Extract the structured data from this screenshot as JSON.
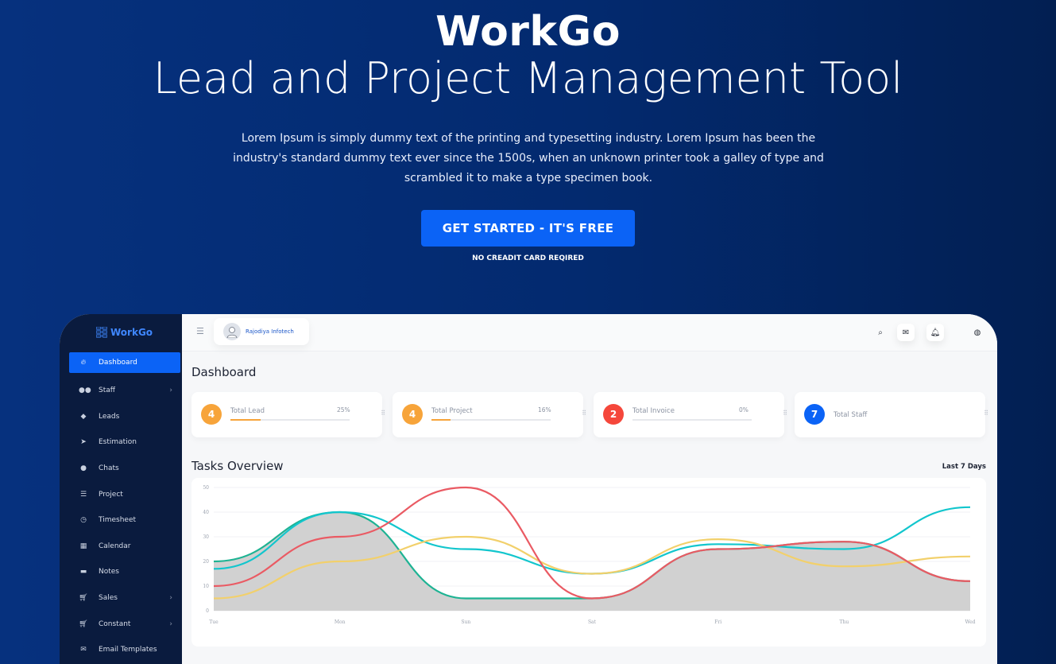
{
  "hero": {
    "brand": "WorkGo",
    "headline": "Lead and Project Management Tool",
    "description": "Lorem Ipsum is simply dummy text of the printing and typesetting industry. Lorem Ipsum has been the industry's standard dummy text ever since the 1500s, when an unknown printer took a galley of type and scrambled it to make a type specimen book.",
    "cta_label": "GET STARTED - IT'S FREE",
    "cta_note": "NO CREADIT CARD REQIRED"
  },
  "app": {
    "logo": "WorkGo",
    "sidebar": {
      "items": [
        {
          "label": "Dashboard",
          "icon": "fire-icon",
          "active": true
        },
        {
          "label": "Staff",
          "icon": "users-icon",
          "chevron": true
        },
        {
          "label": "Leads",
          "icon": "cube-icon"
        },
        {
          "label": "Estimation",
          "icon": "paper-plane-icon"
        },
        {
          "label": "Chats",
          "icon": "chat-icon"
        },
        {
          "label": "Project",
          "icon": "list-icon"
        },
        {
          "label": "Timesheet",
          "icon": "clock-icon"
        },
        {
          "label": "Calendar",
          "icon": "calendar-icon"
        },
        {
          "label": "Notes",
          "icon": "note-icon"
        },
        {
          "label": "Sales",
          "icon": "cart-icon",
          "chevron": true
        },
        {
          "label": "Constant",
          "icon": "cart-icon",
          "chevron": true
        },
        {
          "label": "Email Templates",
          "icon": "mail-icon"
        }
      ]
    },
    "topbar": {
      "user_name": "Rajodiya Infotech",
      "icons": [
        "menu-icon",
        "search-icon",
        "mail-icon",
        "bell-icon",
        "globe-icon"
      ]
    },
    "page_title": "Dashboard",
    "stats": [
      {
        "value": "4",
        "label": "Total Lead",
        "percent": "25%",
        "progress": 0.25,
        "color": "#f7a43a"
      },
      {
        "value": "4",
        "label": "Total Project",
        "percent": "16%",
        "progress": 0.16,
        "color": "#f7a43a"
      },
      {
        "value": "2",
        "label": "Total Invoice",
        "percent": "0%",
        "progress": 0,
        "color": "#f5473b"
      },
      {
        "value": "7",
        "label": "Total Staff",
        "color": "#0b63f6"
      }
    ],
    "tasks_title": "Tasks Overview",
    "range_label": "Last 7 Days"
  },
  "chart_data": {
    "type": "line",
    "categories": [
      "Tue",
      "Mon",
      "Sun",
      "Sat",
      "Fri",
      "Thu",
      "Wed"
    ],
    "ylim": [
      0,
      50
    ],
    "yticks": [
      0,
      10,
      20,
      30,
      40,
      50
    ],
    "grid": true,
    "series": [
      {
        "color": "#1eb393",
        "values": [
          20,
          40,
          5,
          5,
          25,
          28,
          12
        ],
        "fill": "#d1d1d1"
      },
      {
        "color": "#12c6cd",
        "values": [
          17,
          40,
          25,
          15,
          27,
          25,
          42
        ]
      },
      {
        "color": "#f2d06b",
        "values": [
          5,
          20,
          30,
          15,
          29,
          18,
          22
        ]
      },
      {
        "color": "#ea5a63",
        "values": [
          10,
          30,
          50,
          5,
          25,
          28,
          12
        ]
      }
    ]
  }
}
